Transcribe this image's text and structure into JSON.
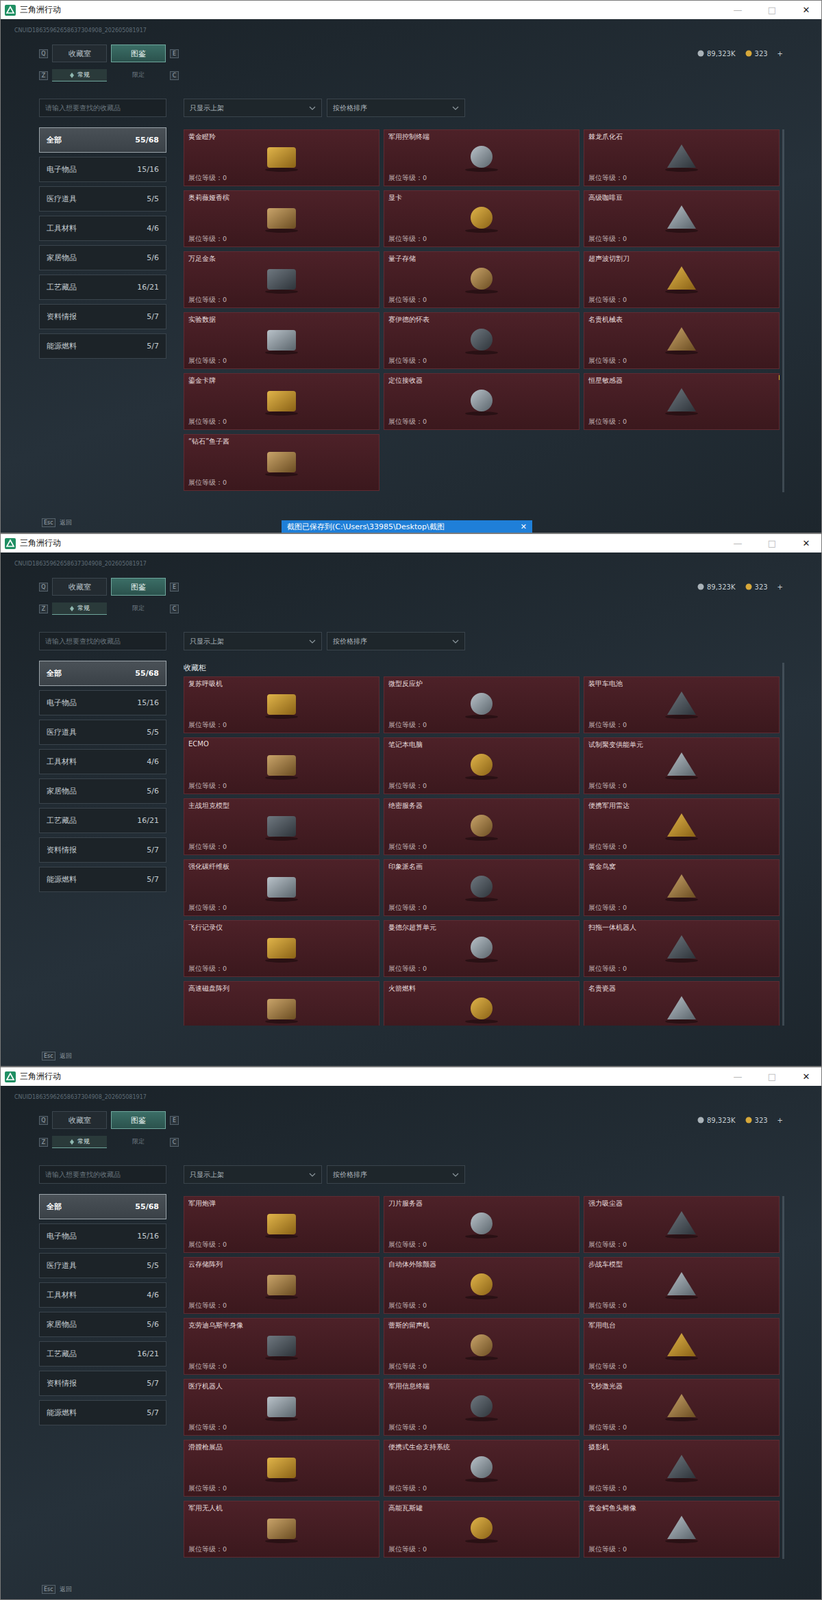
{
  "app": {
    "title": "三角洲行动",
    "controls": [
      "—",
      "□",
      "✕"
    ],
    "uid": "CNUID18635962658637304908_202605081917",
    "tabs": [
      {
        "label": "收藏室",
        "selected": false
      },
      {
        "label": "图鉴",
        "selected": true
      }
    ],
    "tab_keys": [
      "Q",
      "E"
    ],
    "subtabs": [
      {
        "label": "常规",
        "selected": true
      },
      {
        "label": "限定",
        "selected": false
      }
    ],
    "subtab_keys": [
      "Z",
      "C"
    ],
    "currency": [
      {
        "amount": "89,323K",
        "kind": "silver"
      },
      {
        "amount": "323",
        "kind": "gold"
      }
    ],
    "add": "+",
    "search": {
      "placeholder": "请输入想要查找的收藏品"
    },
    "filters": [
      "只显示上架",
      "按价格排序"
    ],
    "sidebar": [
      {
        "label": "全部",
        "count": "55/68",
        "selected": true
      },
      {
        "label": "电子物品",
        "count": "15/16",
        "selected": false
      },
      {
        "label": "医疗道具",
        "count": "5/5",
        "selected": false
      },
      {
        "label": "工具材料",
        "count": "4/6",
        "selected": false
      },
      {
        "label": "家居物品",
        "count": "5/6",
        "selected": false
      },
      {
        "label": "工艺藏品",
        "count": "16/21",
        "selected": false
      },
      {
        "label": "资料情报",
        "count": "5/7",
        "selected": false
      },
      {
        "label": "能源燃料",
        "count": "5/7",
        "selected": false
      }
    ],
    "footer": {
      "key": "Esc",
      "label": "返回"
    }
  },
  "windows": [
    {
      "section": null,
      "toast": {
        "text": "截图已保存到(C:\\Users\\33985\\Desktop\\截图",
        "close": "✕"
      },
      "items": [
        {
          "name": "黄金瞪羚",
          "level": "展位等级：0",
          "marked": false
        },
        {
          "name": "军用控制终端",
          "level": "展位等级：0",
          "marked": false
        },
        {
          "name": "棘龙爪化石",
          "level": "展位等级：0",
          "marked": false
        },
        {
          "name": "奥莉薇娅香槟",
          "level": "展位等级：0",
          "marked": false
        },
        {
          "name": "显卡",
          "level": "展位等级：0",
          "marked": false
        },
        {
          "name": "高级咖啡豆",
          "level": "展位等级：0",
          "marked": false
        },
        {
          "name": "万足金条",
          "level": "展位等级：0",
          "marked": false
        },
        {
          "name": "量子存储",
          "level": "展位等级：0",
          "marked": false
        },
        {
          "name": "超声波切割刀",
          "level": "展位等级：0",
          "marked": false
        },
        {
          "name": "实验数据",
          "level": "展位等级：0",
          "marked": false
        },
        {
          "name": "赛伊德的怀表",
          "level": "展位等级：0",
          "marked": false
        },
        {
          "name": "名贵机械表",
          "level": "展位等级：0",
          "marked": false
        },
        {
          "name": "鎏金卡牌",
          "level": "展位等级：0",
          "marked": false
        },
        {
          "name": "定位接收器",
          "level": "展位等级：0",
          "marked": false
        },
        {
          "name": "恒星敏感器",
          "level": "展位等级：0",
          "marked": true
        },
        {
          "name": "“钻石”鱼子酱",
          "level": "展位等级：0",
          "marked": false
        }
      ]
    },
    {
      "section": "收藏柜",
      "toast": null,
      "items": [
        {
          "name": "复苏呼吸机",
          "level": "展位等级：0",
          "marked": false
        },
        {
          "name": "微型反应炉",
          "level": "展位等级：0",
          "marked": false
        },
        {
          "name": "装甲车电池",
          "level": "展位等级：0",
          "marked": false
        },
        {
          "name": "ECMO",
          "level": "展位等级：0",
          "marked": false
        },
        {
          "name": "笔记本电脑",
          "level": "展位等级：0",
          "marked": false
        },
        {
          "name": "试制聚变供能单元",
          "level": "展位等级：0",
          "marked": false
        },
        {
          "name": "主战坦克模型",
          "level": "展位等级：0",
          "marked": false
        },
        {
          "name": "绝密服务器",
          "level": "展位等级：0",
          "marked": false
        },
        {
          "name": "便携军用雷达",
          "level": "展位等级：0",
          "marked": false
        },
        {
          "name": "强化碳纤维板",
          "level": "展位等级：0",
          "marked": false
        },
        {
          "name": "印象派名画",
          "level": "展位等级：0",
          "marked": false
        },
        {
          "name": "黄金鸟窝",
          "level": "展位等级：0",
          "marked": false
        },
        {
          "name": "飞行记录仪",
          "level": "展位等级：0",
          "marked": false
        },
        {
          "name": "曼德尔超算单元",
          "level": "展位等级：0",
          "marked": false
        },
        {
          "name": "扫拖一体机器人",
          "level": "展位等级：0",
          "marked": false
        },
        {
          "name": "高速磁盘阵列",
          "marked": false
        },
        {
          "name": "火箭燃料",
          "marked": false
        },
        {
          "name": "名贵瓷器",
          "marked": false
        }
      ]
    },
    {
      "section": null,
      "toast": null,
      "items": [
        {
          "name": "军用炮弹",
          "level": "展位等级：0",
          "marked": false
        },
        {
          "name": "刀片服务器",
          "level": "展位等级：0",
          "marked": false
        },
        {
          "name": "强力吸尘器",
          "level": "展位等级：0",
          "marked": false
        },
        {
          "name": "云存储阵列",
          "level": "展位等级：0",
          "marked": false
        },
        {
          "name": "自动体外除颤器",
          "level": "展位等级：0",
          "marked": false
        },
        {
          "name": "步战车模型",
          "level": "展位等级：0",
          "marked": false
        },
        {
          "name": "克劳迪乌斯半身像",
          "level": "展位等级：0",
          "marked": false
        },
        {
          "name": "蕾斯的留声机",
          "level": "展位等级：0",
          "marked": false
        },
        {
          "name": "军用电台",
          "level": "展位等级：0",
          "marked": false
        },
        {
          "name": "医疗机器人",
          "level": "展位等级：0",
          "marked": false
        },
        {
          "name": "军用信息终端",
          "level": "展位等级：0",
          "marked": false
        },
        {
          "name": "飞秒激光器",
          "level": "展位等级：0",
          "marked": false
        },
        {
          "name": "滑膛枪展品",
          "level": "展位等级：0",
          "marked": false
        },
        {
          "name": "便携式生命支持系统",
          "level": "展位等级：0",
          "marked": false
        },
        {
          "name": "摄影机",
          "level": "展位等级：0",
          "marked": false
        },
        {
          "name": "军用无人机",
          "level": "展位等级：0",
          "marked": false
        },
        {
          "name": "高能瓦斯罐",
          "level": "展位等级：0",
          "marked": false
        },
        {
          "name": "黄金鳄鱼头雕像",
          "level": "展位等级：0",
          "marked": false
        }
      ]
    }
  ]
}
